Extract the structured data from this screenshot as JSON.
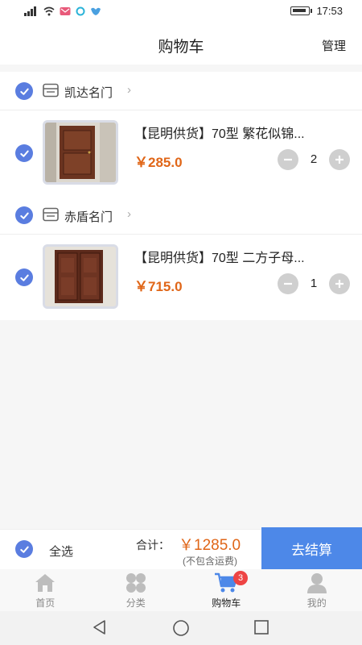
{
  "status_bar": {
    "time": "17:53"
  },
  "header": {
    "title": "购物车",
    "manage_label": "管理"
  },
  "groups": [
    {
      "store_name": "凯达名门",
      "item": {
        "title": "【昆明供货】70型 繁花似锦...",
        "price": "￥285.0",
        "quantity": "2"
      }
    },
    {
      "store_name": "赤盾名门",
      "item": {
        "title": "【昆明供货】70型 二方子母...",
        "price": "￥715.0",
        "quantity": "1"
      }
    }
  ],
  "bottom": {
    "select_all_label": "全选",
    "total_label": "合计：",
    "total_value": "￥1285.0",
    "shipping_note": "(不包含运费)",
    "checkout_label": "去结算"
  },
  "tabs": [
    {
      "label": "首页",
      "icon": "home-icon"
    },
    {
      "label": "分类",
      "icon": "category-icon"
    },
    {
      "label": "购物车",
      "icon": "cart-icon",
      "badge": "3",
      "active": true
    },
    {
      "label": "我的",
      "icon": "user-icon"
    }
  ],
  "colors": {
    "accent": "#5a7de0",
    "price": "#e06618",
    "checkout": "#4d88e8",
    "badge": "#e44444"
  }
}
